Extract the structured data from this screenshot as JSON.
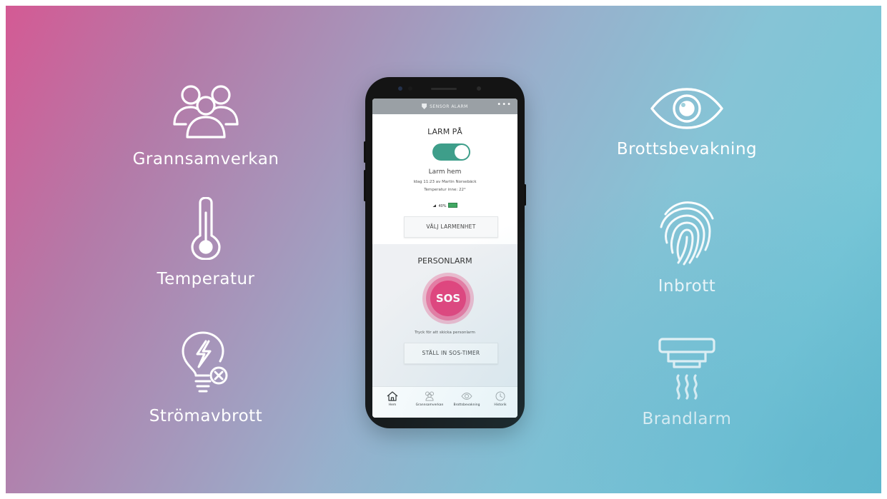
{
  "features": [
    {
      "label": "Grannsamverkan",
      "icon": "people-group-icon"
    },
    {
      "label": "Temperatur",
      "icon": "thermometer-icon"
    },
    {
      "label": "Strömavbrott",
      "icon": "lightbulb-power-off-icon"
    },
    {
      "label": "Brottsbevakning",
      "icon": "eye-icon"
    },
    {
      "label": "Inbrott",
      "icon": "fingerprint-icon"
    },
    {
      "label": "Brandlarm",
      "icon": "smoke-detector-icon"
    }
  ],
  "app": {
    "brand": "SENSOR ALARM",
    "menu": "•••",
    "alarm": {
      "title": "LARM PÅ",
      "enabled": true,
      "mode": "Larm hem",
      "last_change": "Idag 11:23 av Martin Norsebäck",
      "temperature": "Temperatur inne: 22°",
      "battery": "40%",
      "select_unit_button": "VÄLJ LARMENHET"
    },
    "personal": {
      "title": "PERSONLARM",
      "sos_label": "SOS",
      "hint": "Tryck för att skicka personlarm",
      "timer_button": "STÄLL IN SOS-TIMER"
    },
    "tabs": [
      {
        "label": "Hem",
        "icon": "home-icon"
      },
      {
        "label": "Grannsamverkan",
        "icon": "people-group-icon"
      },
      {
        "label": "Brottsbevakning",
        "icon": "eye-icon"
      },
      {
        "label": "Historik",
        "icon": "history-icon"
      }
    ]
  },
  "colors": {
    "accent_green": "#3e9e8a",
    "sos_pink": "#e2447d",
    "background_left": "#d45a94",
    "background_right": "#66bccf"
  }
}
